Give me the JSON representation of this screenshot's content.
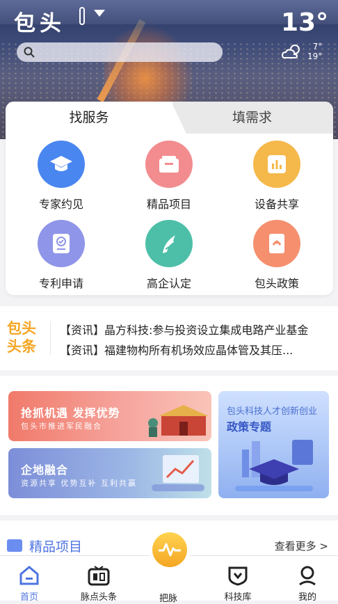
{
  "header": {
    "city": "包头",
    "temperature": "13°",
    "temp_low": "7°",
    "temp_high": "19°",
    "weather_icon": "cloudy-sun-icon",
    "search_placeholder": ""
  },
  "service_tabs": [
    "找服务",
    "填需求"
  ],
  "services": [
    {
      "label": "专家约见",
      "icon": "graduation-cap-icon",
      "color": "#4a86f0"
    },
    {
      "label": "精品项目",
      "icon": "box-icon",
      "color": "#f28c8f"
    },
    {
      "label": "设备共享",
      "icon": "chart-icon",
      "color": "#f5b84a"
    },
    {
      "label": "专利申请",
      "icon": "certificate-icon",
      "color": "#8f95e8"
    },
    {
      "label": "高企认定",
      "icon": "leaf-icon",
      "color": "#4dbfa8"
    },
    {
      "label": "包头政策",
      "icon": "document-icon",
      "color": "#f58f6e"
    }
  ],
  "news": {
    "logo_line1": "包头",
    "logo_line2": "头条",
    "items": [
      "【资讯】晶方科技:参与投资设立集成电路产业基金",
      "【资讯】福建物构所有机场效应晶体管及其压..."
    ]
  },
  "banners": {
    "b1_title": "抢抓机遇 发挥优势",
    "b1_sub": "包头市推进军民融合",
    "b2_title": "企地融合",
    "b2_sub": "资源共享 优势互补 互利共赢",
    "b3_title1": "包头科技人才创新创业",
    "b3_title2": "政策专题"
  },
  "featured": {
    "title": "精品项目",
    "more": "查看更多 >"
  },
  "tabbar": [
    {
      "label": "首页",
      "icon": "home-icon",
      "active": true
    },
    {
      "label": "脉点头条",
      "icon": "news-icon",
      "active": false
    },
    {
      "label": "把脉",
      "icon": "pulse-icon",
      "active": false
    },
    {
      "label": "科技库",
      "icon": "shield-icon",
      "active": false
    },
    {
      "label": "我的",
      "icon": "user-icon",
      "active": false
    }
  ],
  "colors": {
    "accent": "#4f74e0",
    "news_logo": "#f5a623"
  }
}
